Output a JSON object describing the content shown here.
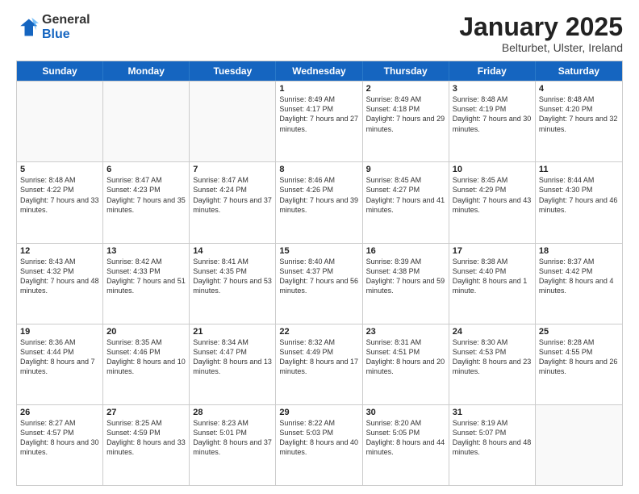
{
  "logo": {
    "general": "General",
    "blue": "Blue"
  },
  "title": "January 2025",
  "subtitle": "Belturbet, Ulster, Ireland",
  "header_days": [
    "Sunday",
    "Monday",
    "Tuesday",
    "Wednesday",
    "Thursday",
    "Friday",
    "Saturday"
  ],
  "rows": [
    [
      {
        "day": "",
        "sunrise": "",
        "sunset": "",
        "daylight": ""
      },
      {
        "day": "",
        "sunrise": "",
        "sunset": "",
        "daylight": ""
      },
      {
        "day": "",
        "sunrise": "",
        "sunset": "",
        "daylight": ""
      },
      {
        "day": "1",
        "sunrise": "Sunrise: 8:49 AM",
        "sunset": "Sunset: 4:17 PM",
        "daylight": "Daylight: 7 hours and 27 minutes."
      },
      {
        "day": "2",
        "sunrise": "Sunrise: 8:49 AM",
        "sunset": "Sunset: 4:18 PM",
        "daylight": "Daylight: 7 hours and 29 minutes."
      },
      {
        "day": "3",
        "sunrise": "Sunrise: 8:48 AM",
        "sunset": "Sunset: 4:19 PM",
        "daylight": "Daylight: 7 hours and 30 minutes."
      },
      {
        "day": "4",
        "sunrise": "Sunrise: 8:48 AM",
        "sunset": "Sunset: 4:20 PM",
        "daylight": "Daylight: 7 hours and 32 minutes."
      }
    ],
    [
      {
        "day": "5",
        "sunrise": "Sunrise: 8:48 AM",
        "sunset": "Sunset: 4:22 PM",
        "daylight": "Daylight: 7 hours and 33 minutes."
      },
      {
        "day": "6",
        "sunrise": "Sunrise: 8:47 AM",
        "sunset": "Sunset: 4:23 PM",
        "daylight": "Daylight: 7 hours and 35 minutes."
      },
      {
        "day": "7",
        "sunrise": "Sunrise: 8:47 AM",
        "sunset": "Sunset: 4:24 PM",
        "daylight": "Daylight: 7 hours and 37 minutes."
      },
      {
        "day": "8",
        "sunrise": "Sunrise: 8:46 AM",
        "sunset": "Sunset: 4:26 PM",
        "daylight": "Daylight: 7 hours and 39 minutes."
      },
      {
        "day": "9",
        "sunrise": "Sunrise: 8:45 AM",
        "sunset": "Sunset: 4:27 PM",
        "daylight": "Daylight: 7 hours and 41 minutes."
      },
      {
        "day": "10",
        "sunrise": "Sunrise: 8:45 AM",
        "sunset": "Sunset: 4:29 PM",
        "daylight": "Daylight: 7 hours and 43 minutes."
      },
      {
        "day": "11",
        "sunrise": "Sunrise: 8:44 AM",
        "sunset": "Sunset: 4:30 PM",
        "daylight": "Daylight: 7 hours and 46 minutes."
      }
    ],
    [
      {
        "day": "12",
        "sunrise": "Sunrise: 8:43 AM",
        "sunset": "Sunset: 4:32 PM",
        "daylight": "Daylight: 7 hours and 48 minutes."
      },
      {
        "day": "13",
        "sunrise": "Sunrise: 8:42 AM",
        "sunset": "Sunset: 4:33 PM",
        "daylight": "Daylight: 7 hours and 51 minutes."
      },
      {
        "day": "14",
        "sunrise": "Sunrise: 8:41 AM",
        "sunset": "Sunset: 4:35 PM",
        "daylight": "Daylight: 7 hours and 53 minutes."
      },
      {
        "day": "15",
        "sunrise": "Sunrise: 8:40 AM",
        "sunset": "Sunset: 4:37 PM",
        "daylight": "Daylight: 7 hours and 56 minutes."
      },
      {
        "day": "16",
        "sunrise": "Sunrise: 8:39 AM",
        "sunset": "Sunset: 4:38 PM",
        "daylight": "Daylight: 7 hours and 59 minutes."
      },
      {
        "day": "17",
        "sunrise": "Sunrise: 8:38 AM",
        "sunset": "Sunset: 4:40 PM",
        "daylight": "Daylight: 8 hours and 1 minute."
      },
      {
        "day": "18",
        "sunrise": "Sunrise: 8:37 AM",
        "sunset": "Sunset: 4:42 PM",
        "daylight": "Daylight: 8 hours and 4 minutes."
      }
    ],
    [
      {
        "day": "19",
        "sunrise": "Sunrise: 8:36 AM",
        "sunset": "Sunset: 4:44 PM",
        "daylight": "Daylight: 8 hours and 7 minutes."
      },
      {
        "day": "20",
        "sunrise": "Sunrise: 8:35 AM",
        "sunset": "Sunset: 4:46 PM",
        "daylight": "Daylight: 8 hours and 10 minutes."
      },
      {
        "day": "21",
        "sunrise": "Sunrise: 8:34 AM",
        "sunset": "Sunset: 4:47 PM",
        "daylight": "Daylight: 8 hours and 13 minutes."
      },
      {
        "day": "22",
        "sunrise": "Sunrise: 8:32 AM",
        "sunset": "Sunset: 4:49 PM",
        "daylight": "Daylight: 8 hours and 17 minutes."
      },
      {
        "day": "23",
        "sunrise": "Sunrise: 8:31 AM",
        "sunset": "Sunset: 4:51 PM",
        "daylight": "Daylight: 8 hours and 20 minutes."
      },
      {
        "day": "24",
        "sunrise": "Sunrise: 8:30 AM",
        "sunset": "Sunset: 4:53 PM",
        "daylight": "Daylight: 8 hours and 23 minutes."
      },
      {
        "day": "25",
        "sunrise": "Sunrise: 8:28 AM",
        "sunset": "Sunset: 4:55 PM",
        "daylight": "Daylight: 8 hours and 26 minutes."
      }
    ],
    [
      {
        "day": "26",
        "sunrise": "Sunrise: 8:27 AM",
        "sunset": "Sunset: 4:57 PM",
        "daylight": "Daylight: 8 hours and 30 minutes."
      },
      {
        "day": "27",
        "sunrise": "Sunrise: 8:25 AM",
        "sunset": "Sunset: 4:59 PM",
        "daylight": "Daylight: 8 hours and 33 minutes."
      },
      {
        "day": "28",
        "sunrise": "Sunrise: 8:23 AM",
        "sunset": "Sunset: 5:01 PM",
        "daylight": "Daylight: 8 hours and 37 minutes."
      },
      {
        "day": "29",
        "sunrise": "Sunrise: 8:22 AM",
        "sunset": "Sunset: 5:03 PM",
        "daylight": "Daylight: 8 hours and 40 minutes."
      },
      {
        "day": "30",
        "sunrise": "Sunrise: 8:20 AM",
        "sunset": "Sunset: 5:05 PM",
        "daylight": "Daylight: 8 hours and 44 minutes."
      },
      {
        "day": "31",
        "sunrise": "Sunrise: 8:19 AM",
        "sunset": "Sunset: 5:07 PM",
        "daylight": "Daylight: 8 hours and 48 minutes."
      },
      {
        "day": "",
        "sunrise": "",
        "sunset": "",
        "daylight": ""
      }
    ]
  ]
}
